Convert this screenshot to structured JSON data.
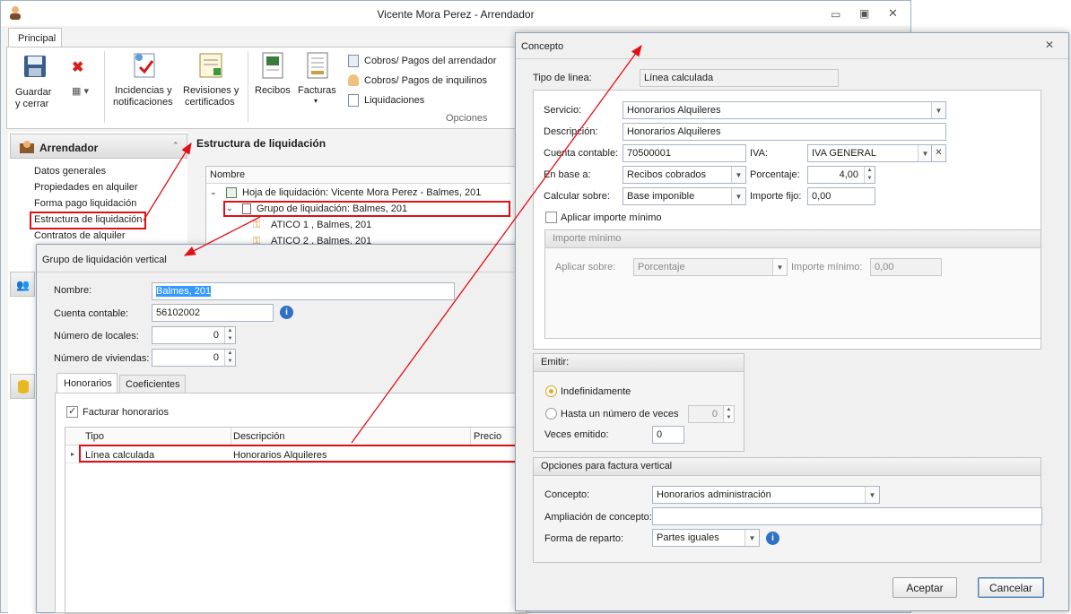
{
  "main_window": {
    "title": "Vicente Mora Perez - Arrendador",
    "ribbon_tab": "Principal",
    "ribbon": {
      "save_line1": "Guardar",
      "save_line2": "y cerrar",
      "incidencias_line1": "Incidencias y",
      "incidencias_line2": "notificaciones",
      "revisiones_line1": "Revisiones y",
      "revisiones_line2": "certificados",
      "recibos": "Recibos",
      "facturas": "Facturas",
      "cobros_arrendador": "Cobros/ Pagos del arrendador",
      "cobros_inquilinos": "Cobros/ Pagos de inquilinos",
      "liquidaciones": "Liquidaciones",
      "group_opciones": "Opciones"
    },
    "sidebar": {
      "header": "Arrendador",
      "items": [
        "Datos generales",
        "Propiedades en alquiler",
        "Forma pago liquidación",
        "Estructura de liquidación",
        "Contratos de alquiler"
      ]
    },
    "structure": {
      "title": "Estructura de liquidación",
      "column_name": "Nombre",
      "tree": [
        "Hoja de liquidación: Vicente Mora Perez - Balmes, 201",
        "Grupo de liquidación: Balmes, 201",
        "ATICO 1 , Balmes, 201",
        "ATICO 2 , Balmes, 201"
      ]
    }
  },
  "grupo_dialog": {
    "title": "Grupo de liquidación vertical",
    "nombre_label": "Nombre:",
    "nombre_value": "Balmes, 201",
    "cuenta_label": "Cuenta contable:",
    "cuenta_value": "56102002",
    "locales_label": "Número de locales:",
    "locales_value": "0",
    "viviendas_label": "Número de viviendas:",
    "viviendas_value": "0",
    "tab_honorarios": "Honorarios",
    "tab_coeficientes": "Coeficientes",
    "facturar_label": "Facturar honorarios",
    "grid_headers": [
      "Tipo",
      "Descripción",
      "Precio"
    ],
    "grid_row": {
      "tipo": "Línea calculada",
      "descripcion": "Honorarios Alquileres"
    }
  },
  "concepto_dialog": {
    "title": "Concepto",
    "tipo_linea_label": "Tipo de linea:",
    "tipo_linea_value": "Línea calculada",
    "servicio_label": "Servicio:",
    "servicio_value": "Honorarios Alquileres",
    "descripcion_label": "Descripción:",
    "descripcion_value": "Honorarios Alquileres",
    "cuenta_label": "Cuenta contable:",
    "cuenta_value": "70500001",
    "iva_label": "IVA:",
    "iva_value": "IVA GENERAL",
    "en_base_label": "En base a:",
    "en_base_value": "Recibos cobrados",
    "porcentaje_label": "Porcentaje:",
    "porcentaje_value": "4,00",
    "calcular_label": "Calcular sobre:",
    "calcular_value": "Base imponible",
    "importe_fijo_label": "Importe fijo:",
    "importe_fijo_value": "0,00",
    "aplicar_minimo_label": "Aplicar importe mínimo",
    "importe_minimo_group": "Importe mínimo",
    "aplicar_sobre_label": "Aplicar sobre:",
    "aplicar_sobre_value": "Porcentaje",
    "importe_minimo_label": "Importe mínimo:",
    "importe_minimo_value": "0,00",
    "emitir_group": "Emitir:",
    "indefinidamente_label": "Indefinidamente",
    "hasta_label": "Hasta un número de veces",
    "hasta_value": "0",
    "veces_label": "Veces emitido:",
    "veces_value": "0",
    "opciones_group": "Opciones para factura vertical",
    "concepto_label": "Concepto:",
    "concepto_value": "Honorarios administración",
    "ampliacion_label": "Ampliación de concepto:",
    "forma_label": "Forma de reparto:",
    "forma_value": "Partes iguales",
    "aceptar": "Aceptar",
    "cancelar": "Cancelar"
  },
  "colors": {
    "accent_red": "#e30f16",
    "selection_blue": "#3399ff",
    "info_blue": "#2f6fc6"
  }
}
